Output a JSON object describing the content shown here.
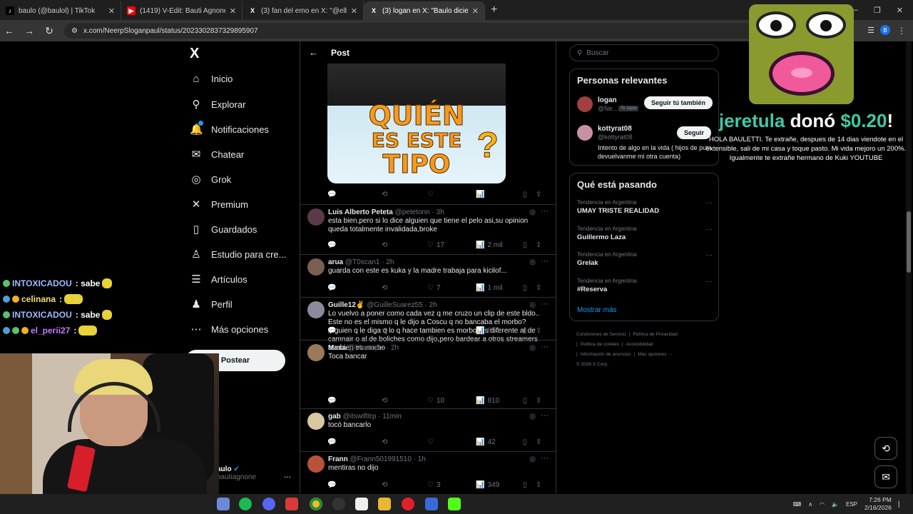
{
  "browser": {
    "tabs": [
      {
        "title": "baulo (@baulol) | TikTok",
        "icon": "tiktok-icon",
        "color": "#000000"
      },
      {
        "title": "(1419) V-Edit: Bauti Agnone - Y",
        "icon": "youtube-icon",
        "color": "#ff0000"
      },
      {
        "title": "(3) fan del emo en X: \"@elbajat",
        "icon": "x-icon",
        "color": "#000000"
      },
      {
        "title": "(3) logan en X: \"Baulo diciendo",
        "icon": "x-icon",
        "color": "#000000"
      }
    ],
    "new_tab": "+",
    "url": "x.com/NeerpSloganpaul/status/2023302837329895907",
    "profile_letter": "B"
  },
  "nav": {
    "logo": "X",
    "items": [
      {
        "label": "Inicio",
        "icon": "home-icon",
        "glyph": "⌂"
      },
      {
        "label": "Explorar",
        "icon": "search-icon",
        "glyph": "⚲"
      },
      {
        "label": "Notificaciones",
        "icon": "bell-icon",
        "glyph": "🔔"
      },
      {
        "label": "Chatear",
        "icon": "mail-icon",
        "glyph": "✉"
      },
      {
        "label": "Grok",
        "icon": "grok-icon",
        "glyph": "◎"
      },
      {
        "label": "Premium",
        "icon": "x-premium-icon",
        "glyph": "✕"
      },
      {
        "label": "Guardados",
        "icon": "bookmark-icon",
        "glyph": "▯"
      },
      {
        "label": "Estudio para cre...",
        "icon": "studio-icon",
        "glyph": "♙"
      },
      {
        "label": "Artículos",
        "icon": "articles-icon",
        "glyph": "☰"
      },
      {
        "label": "Perfil",
        "icon": "profile-icon",
        "glyph": "♟"
      },
      {
        "label": "Más opciones",
        "icon": "more-options-icon",
        "glyph": "⋯"
      }
    ],
    "post_button": "Postear",
    "account_name": "aulo",
    "account_handle": "bautiagnone",
    "account_more": "..."
  },
  "main": {
    "back": "←",
    "title": "Post",
    "media_text": [
      "QUIÉN",
      "ES ESTE",
      "TIPO"
    ],
    "media_q": "?",
    "media_actions": {
      "replies": "",
      "reposts": "",
      "likes": "",
      "views": ""
    },
    "replies": [
      {
        "name": "Luis Alberto Peteta",
        "handle": "@petetonn · 3h",
        "text": "esta bien,pero si lo dice alguien que tiene el pelo asi,su opinion queda totalmente invalidada,broke",
        "replies": "",
        "reposts": "",
        "likes": "17",
        "views": "2 mil",
        "avatar": "#5a3a4a"
      },
      {
        "name": "arua",
        "handle": "@T0scan1 · 2h",
        "text": "guarda con este es kuka y la madre trabaja para kicilof...",
        "replies": "",
        "reposts": "",
        "likes": "7",
        "views": "1 mil",
        "avatar": "#7a6050"
      },
      {
        "name": "Guille12✌",
        "handle": "@GuilleSuarez55 · 2h",
        "text": "Lo vuelvo a poner como cada vez q me cruzo un clip de este bldo.. Este no es el mismo q le dijo a Coscu q no bancaba el morbo? Alguien q le diga q lo q hace tambien es morbo, es diferente al de camnair o al de boliches como dijo,pero bardear a otros streamers tambien es morbo",
        "replies": "",
        "reposts": "",
        "likes": "",
        "views": "854",
        "avatar": "#8a8a9a"
      },
      {
        "name": "Masa",
        "handle": "@Masarptz · 2h",
        "text": "Toca bancar",
        "replies": "",
        "reposts": "",
        "likes": "10",
        "views": "810",
        "avatar": "#9a7a5a"
      },
      {
        "name": "gab",
        "handle": "@itswifttrp · 11min",
        "text": "tocó bancarlo",
        "replies": "",
        "reposts": "",
        "likes": "",
        "views": "42",
        "avatar": "#d8c8a0"
      },
      {
        "name": "Frann",
        "handle": "@Frann501991510 · 1h",
        "text": "mentiras no dijo",
        "replies": "",
        "reposts": "",
        "likes": "3",
        "views": "349",
        "avatar": "#b8523a"
      }
    ]
  },
  "right": {
    "search_placeholder": "Buscar",
    "relevant_title": "Personas relevantes",
    "people": [
      {
        "name": "logan",
        "handle": "@Ne...",
        "badge": "Te sigue",
        "button": "Seguir tú también",
        "bio": "",
        "avatar": "#a04040"
      },
      {
        "name": "kottyrat08",
        "handle": "@kottyrat08",
        "badge": "",
        "button": "Seguir",
        "bio": "Intento de algo en la vida ( hijos de puta devuelvanme mi otra cuenta)",
        "avatar": "#c890a0"
      }
    ],
    "trends_title": "Qué está pasando",
    "trends": [
      {
        "context": "Tendencia en Argentina",
        "title": "UMAY TRISTE REALIDAD"
      },
      {
        "context": "Tendencia en Argentina",
        "title": "Guillermo Laza"
      },
      {
        "context": "Tendencia en Argentina",
        "title": "Grelak"
      },
      {
        "context": "Tendencia en Argentina",
        "title": "#Reserva"
      }
    ],
    "show_more": "Mostrar más",
    "footer": [
      "Condiciones de Servicio",
      "|",
      "Política de Privacidad",
      "|",
      "Política de cookies",
      "|",
      "Accesibilidad",
      "|",
      "Información de anuncios",
      "|",
      "Más opciones ···",
      "© 2026 X Corp."
    ]
  },
  "stream": {
    "chat": [
      {
        "user": "INTOXICADOU",
        "text": ": sabe",
        "color": "#9fb8ff"
      },
      {
        "user": "celinana",
        "text": ":",
        "color": "#f2e16b"
      },
      {
        "user": "INTOXICADOU",
        "text": ": sabe",
        "color": "#9fb8ff"
      },
      {
        "user": "el_perii27",
        "text": ":",
        "color": "#c07cff"
      }
    ],
    "donation_user": "jeretula",
    "donation_verb": " donó ",
    "donation_amount": "$0.20",
    "donation_bang": "!",
    "donation_message": "HOLA BAULETTI. Te extrañe, despues de 14 dias viendote en el extensible, sali de mi casa y toque pasto. Mi vida mejoro un 200%. Igualmente te extrañe hermano de Kuki YOUTUBE"
  },
  "taskbar": {
    "lang": "ESP",
    "time": "7:26 PM",
    "date": "2/16/2026"
  },
  "colors": {
    "accent": "#1d9bf0",
    "donation": "#3ec9a7"
  }
}
